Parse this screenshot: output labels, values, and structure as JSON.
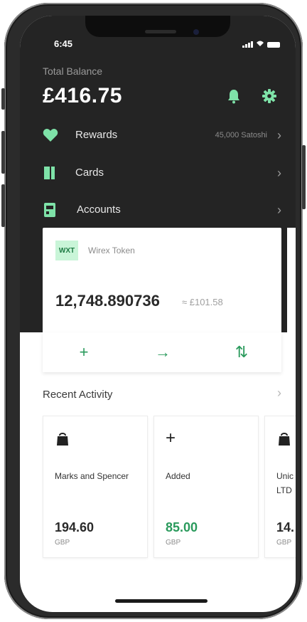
{
  "status": {
    "time": "6:45"
  },
  "header": {
    "balance_label": "Total Balance",
    "balance": "£416.75"
  },
  "menu": [
    {
      "label": "Rewards",
      "meta": "45,000 Satoshi",
      "icon": "heart-icon"
    },
    {
      "label": "Cards",
      "meta": "",
      "icon": "card-icon"
    },
    {
      "label": "Accounts",
      "meta": "",
      "icon": "accounts-icon"
    }
  ],
  "account_card": {
    "badge": "WXT",
    "name": "Wirex Token",
    "balance": "12,748.890736",
    "fiat": "≈ £101.58"
  },
  "actions": [
    {
      "symbol": "+",
      "icon": "plus-icon"
    },
    {
      "symbol": "→",
      "icon": "arrow-right-icon"
    },
    {
      "symbol": "⇅",
      "icon": "exchange-icon"
    }
  ],
  "recent": {
    "title": "Recent Activity",
    "items": [
      {
        "name": "Marks and Spencer",
        "amount": "194.60",
        "currency": "GBP",
        "icon": "shopping-bag-icon",
        "amount_color": "#2a2a2a"
      },
      {
        "name": "Added",
        "amount": "85.00",
        "currency": "GBP",
        "icon": "plus-icon",
        "amount_color": "#2a9a5c"
      },
      {
        "name": "Unic LTD",
        "amount": "14.",
        "currency": "GBP",
        "icon": "shopping-bag-icon",
        "amount_color": "#2a2a2a"
      }
    ]
  },
  "colors": {
    "accent": "#7ee2a8",
    "accent_dark": "#2a9a5c",
    "header_bg": "#242424"
  }
}
